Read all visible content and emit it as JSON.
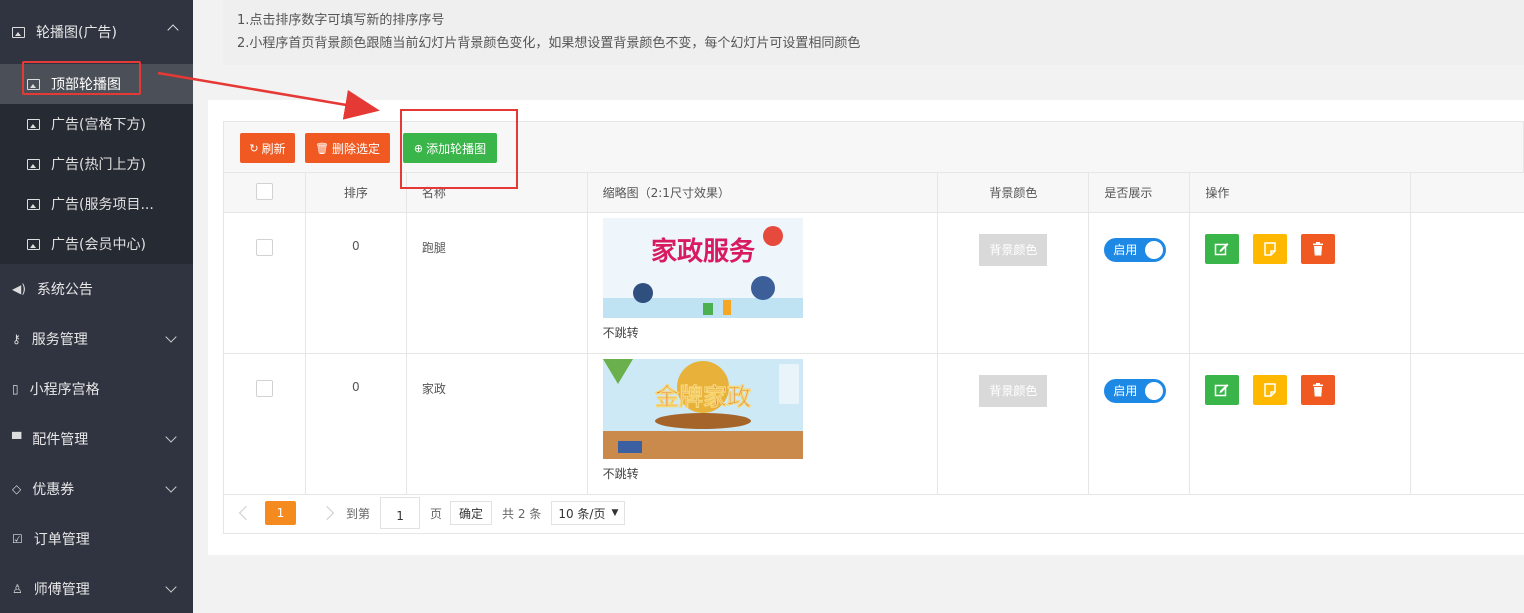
{
  "sidebar": {
    "group": {
      "label": "轮播图(广告)"
    },
    "subitems": [
      {
        "label": "顶部轮播图",
        "active": true
      },
      {
        "label": "广告(宫格下方)"
      },
      {
        "label": "广告(热门上方)"
      },
      {
        "label": "广告(服务项目..."
      },
      {
        "label": "广告(会员中心)"
      }
    ],
    "items": [
      {
        "label": "系统公告",
        "icon": "speaker-icon",
        "glyph": "◀)"
      },
      {
        "label": "服务管理",
        "icon": "key-icon",
        "glyph": "⚷",
        "expandable": true
      },
      {
        "label": "小程序宫格",
        "icon": "mobile-icon",
        "glyph": "▯"
      },
      {
        "label": "配件管理",
        "icon": "cart-icon",
        "glyph": "🛒",
        "expandable": true
      },
      {
        "label": "优惠券",
        "icon": "diamond-icon",
        "glyph": "◇",
        "expandable": true
      },
      {
        "label": "订单管理",
        "icon": "checkbox-icon",
        "glyph": "☑"
      },
      {
        "label": "师傅管理",
        "icon": "person-icon",
        "glyph": "♙",
        "expandable": true
      }
    ]
  },
  "notice": {
    "line1": "1.点击排序数字可填写新的排序序号",
    "line2": "2.小程序首页背景颜色跟随当前幻灯片背景颜色变化，如果想设置背景颜色不变，每个幻灯片可设置相同颜色"
  },
  "toolbar": {
    "refresh_label": "刷新",
    "delete_label": "删除选定",
    "add_label": "添加轮播图"
  },
  "table": {
    "headers": [
      "",
      "排序",
      "名称",
      "缩略图（2:1尺寸效果）",
      "背景颜色",
      "是否展示",
      "操作"
    ],
    "rows": [
      {
        "sort": "0",
        "name": "跑腿",
        "caption": "不跳转",
        "bg_label": "背景颜色",
        "switch_label": "启用",
        "banner_text": "家政服务"
      },
      {
        "sort": "0",
        "name": "家政",
        "caption": "不跳转",
        "bg_label": "背景颜色",
        "switch_label": "启用",
        "banner_text": "金牌家政"
      }
    ]
  },
  "pager": {
    "current": "1",
    "goto_label": "到第",
    "page_value": "1",
    "page_label": "页",
    "confirm_label": "确定",
    "total_label": "共 2 条",
    "size_label": "10 条/页"
  },
  "colors": {
    "sidebar_bg": "#2f3440",
    "orange": "#f05a22",
    "green": "#3ab54a",
    "yellow": "#ffb800",
    "blue": "#1e88e5",
    "annotation_red": "#e53935"
  }
}
